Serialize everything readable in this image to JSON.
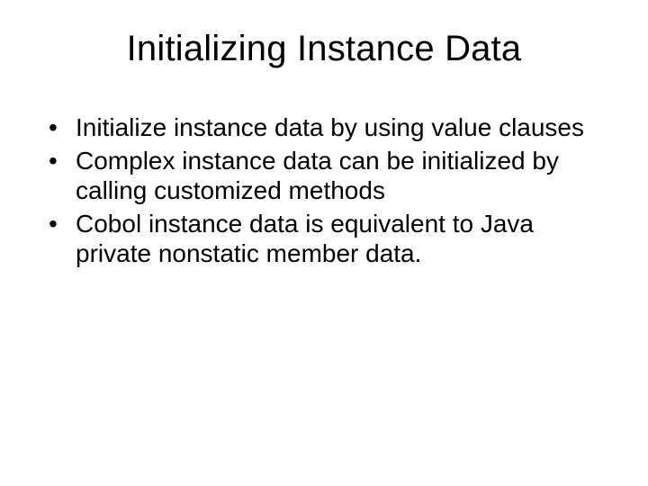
{
  "slide": {
    "title": "Initializing Instance Data",
    "bullets": [
      "Initialize instance data by using value clauses",
      "Complex instance data can be initialized by calling customized methods",
      "Cobol instance data is equivalent to Java private nonstatic member data."
    ]
  }
}
